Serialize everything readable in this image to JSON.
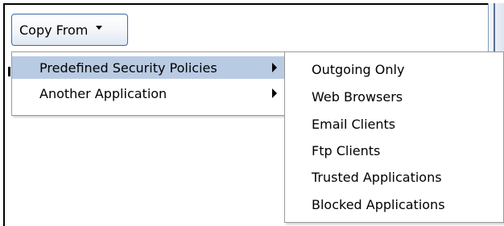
{
  "copy_from_button": {
    "label": "Copy From",
    "icon": "chevron-down-icon"
  },
  "menu": {
    "items": [
      {
        "label": "Predefined Security Policies",
        "selected": true,
        "has_submenu": true
      },
      {
        "label": "Another Application",
        "selected": false,
        "has_submenu": true
      }
    ]
  },
  "submenu": {
    "items": [
      {
        "label": "Outgoing Only"
      },
      {
        "label": "Web Browsers"
      },
      {
        "label": "Email Clients"
      },
      {
        "label": "Ftp Clients"
      },
      {
        "label": "Trusted Applications"
      },
      {
        "label": "Blocked Applications"
      }
    ]
  },
  "colors": {
    "menu_selected_bg": "#b9cbe3",
    "button_border": "#3a6ab0",
    "menu_border": "#9a9a9a"
  }
}
